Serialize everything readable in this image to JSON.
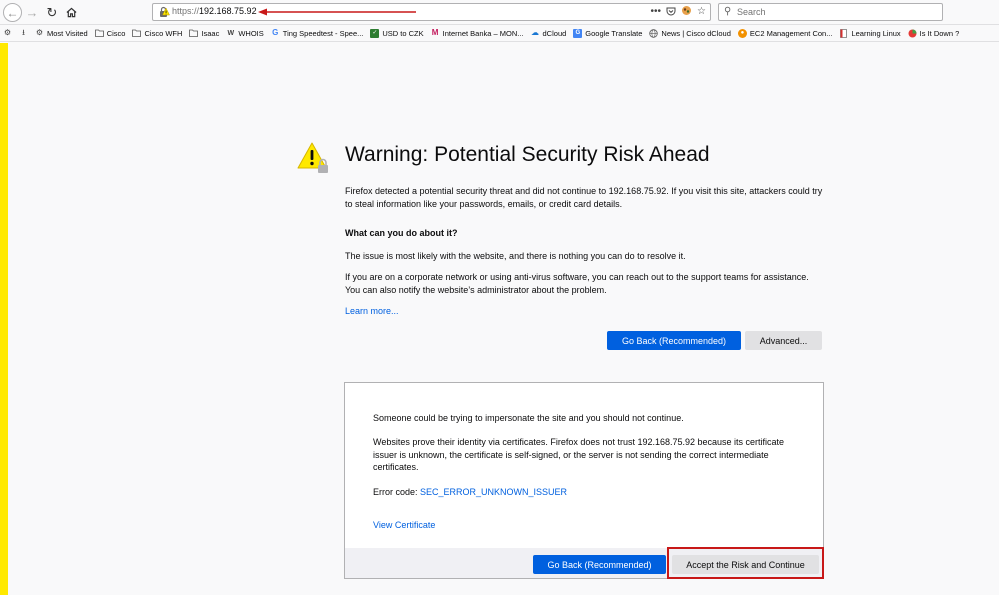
{
  "browser": {
    "url_scheme": "https://",
    "url_host": "192.168.75.92",
    "search_placeholder": "Search",
    "nav_icons": [
      "back-icon",
      "forward-icon",
      "reload-icon",
      "home-icon"
    ]
  },
  "bookmarks": [
    {
      "label": "",
      "icon": "gear-icon"
    },
    {
      "label": "",
      "icon": "tray-icon"
    },
    {
      "label": "Most Visited",
      "icon": "gear-icon"
    },
    {
      "label": "Cisco",
      "icon": "folder-icon"
    },
    {
      "label": "Cisco WFH",
      "icon": "folder-icon"
    },
    {
      "label": "Isaac",
      "icon": "folder-icon"
    },
    {
      "label": "WHOIS",
      "icon": "whois-icon"
    },
    {
      "label": "Ting Speedtest - Spee...",
      "icon": "google-icon"
    },
    {
      "label": "USD to CZK",
      "icon": "currency-icon"
    },
    {
      "label": "Internet Banka – MON...",
      "icon": "bank-icon"
    },
    {
      "label": "dCloud",
      "icon": "cloud-icon"
    },
    {
      "label": "Google Translate",
      "icon": "translate-icon"
    },
    {
      "label": "News | Cisco dCloud",
      "icon": "globe-icon"
    },
    {
      "label": "EC2 Management Con...",
      "icon": "aws-icon"
    },
    {
      "label": "Learning Linux",
      "icon": "linux-icon"
    },
    {
      "label": "Is It Down ?",
      "icon": "status-icon"
    }
  ],
  "warning": {
    "title": "Warning: Potential Security Risk Ahead",
    "intro": "Firefox detected a potential security threat and did not continue to 192.168.75.92. If you visit this site, attackers could try to steal information like your passwords, emails, or credit card details.",
    "heading": "What can you do about it?",
    "p_likely": "The issue is most likely with the website, and there is nothing you can do to resolve it.",
    "p_network": "If you are on a corporate network or using anti-virus software, you can reach out to the support teams for assistance. You can also notify the website’s administrator about the problem.",
    "learn_more": "Learn more...",
    "go_back_label": "Go Back (Recommended)",
    "advanced_label": "Advanced..."
  },
  "advanced_panel": {
    "p_impersonate": "Someone could be trying to impersonate the site and you should not continue.",
    "p_certs": "Websites prove their identity via certificates. Firefox does not trust 192.168.75.92 because its certificate issuer is unknown, the certificate is self-signed, or the server is not sending the correct intermediate certificates.",
    "error_code_label": "Error code: ",
    "error_code": "SEC_ERROR_UNKNOWN_ISSUER",
    "view_certificate": "View Certificate",
    "go_back_label": "Go Back (Recommended)",
    "accept_label": "Accept the Risk and Continue"
  },
  "colors": {
    "accent_blue": "#0060df",
    "warning_yellow": "#ffe900",
    "annotation_red": "#c81818"
  }
}
